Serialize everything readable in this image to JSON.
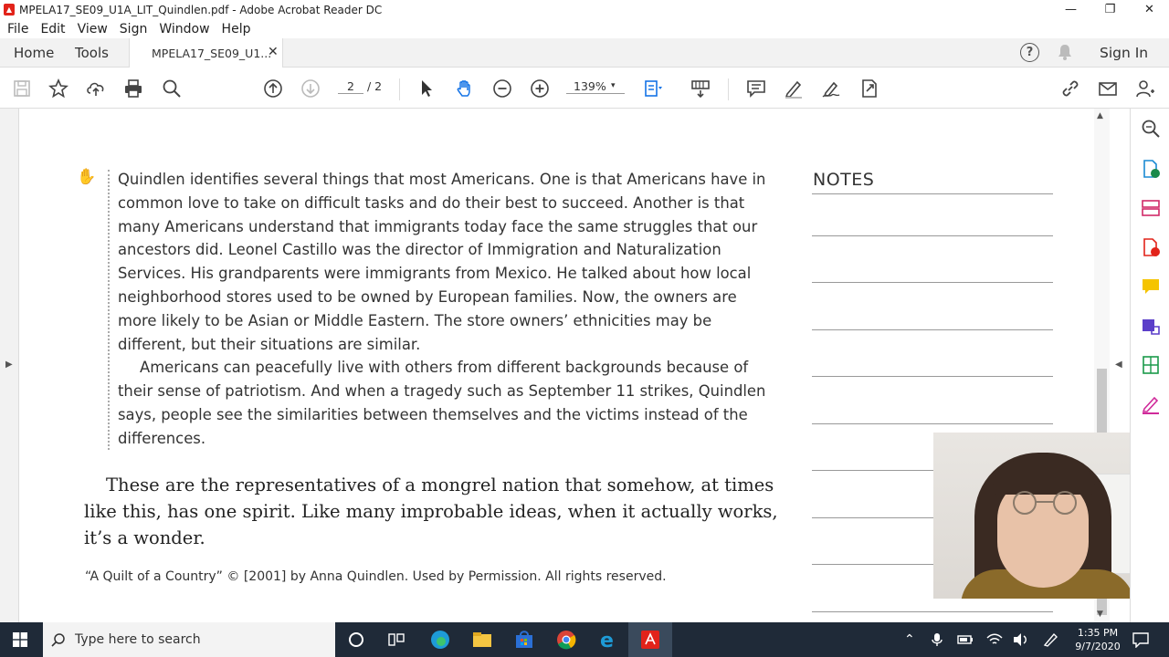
{
  "window": {
    "title": "MPELA17_SE09_U1A_LIT_Quindlen.pdf - Adobe Acrobat Reader DC",
    "minimize": "—",
    "restore": "❐",
    "close": "✕"
  },
  "menu": [
    "File",
    "Edit",
    "View",
    "Sign",
    "Window",
    "Help"
  ],
  "tabs": {
    "home": "Home",
    "tools": "Tools",
    "document": "MPELA17_SE09_U1...",
    "close_glyph": "✕",
    "sign_in": "Sign In",
    "help_glyph": "?"
  },
  "toolbar": {
    "current_page": "2",
    "page_total": "/ 2",
    "zoom": "139%",
    "zoom_caret": "▾"
  },
  "document": {
    "summary_paragraphs": [
      "Quindlen identifies several things that most Americans. One is that Americans have in common love to take on difficult tasks and do their best to succeed. Another is that many Americans understand that immigrants today face the same struggles that our ancestors did. Leonel Castillo was the director of Immigration and Naturalization Services. His grandparents were immigrants from Mexico. He talked about how local neighborhood stores used to be owned by European families. Now, the owners are more likely to be Asian or Middle Eastern. The store owners’ ethnicities may be different, but their situations are similar.",
      "Americans can peacefully live with others from different backgrounds because of their sense of patriotism. And when a tragedy such as September 11 strikes, Quindlen says, people see the similarities between themselves and the victims instead of the differences."
    ],
    "quote": "These are the representatives of a mongrel nation that somehow, at times like this, has one spirit. Like many improbable ideas, when it actually works, it’s a wonder.",
    "credit": "“A Quilt of a Country” © [2001] by Anna Quindlen. Used by Permission. All rights reserved.",
    "notes_heading": "NOTES"
  },
  "taskbar": {
    "search_placeholder": "Type here to search",
    "time": "1:35 PM",
    "date": "9/7/2020"
  },
  "colors": {
    "acrobat_red": "#e2231a",
    "taskbar_bg": "#1f2a38",
    "hand_tool_blue": "#1473e6"
  },
  "icons": {
    "toolbar": [
      "save-icon",
      "bookmark-star-icon",
      "upload-icon",
      "print-icon",
      "search-zoom-icon",
      "page-up-icon",
      "page-down-icon",
      "select-arrow-icon",
      "hand-icon",
      "zoom-out-icon",
      "zoom-in-icon",
      "fit-page-icon",
      "scroll-mode-icon",
      "comment-icon",
      "highlight-pen-icon",
      "sign-icon",
      "share-icon",
      "link-icon",
      "mail-icon",
      "add-user-icon"
    ],
    "right_panel": [
      "panel-search-icon",
      "export-pdf-icon",
      "organize-pages-icon",
      "create-pdf-icon",
      "comment-panel-icon",
      "edit-pdf-icon",
      "compress-icon",
      "fill-sign-icon"
    ]
  }
}
